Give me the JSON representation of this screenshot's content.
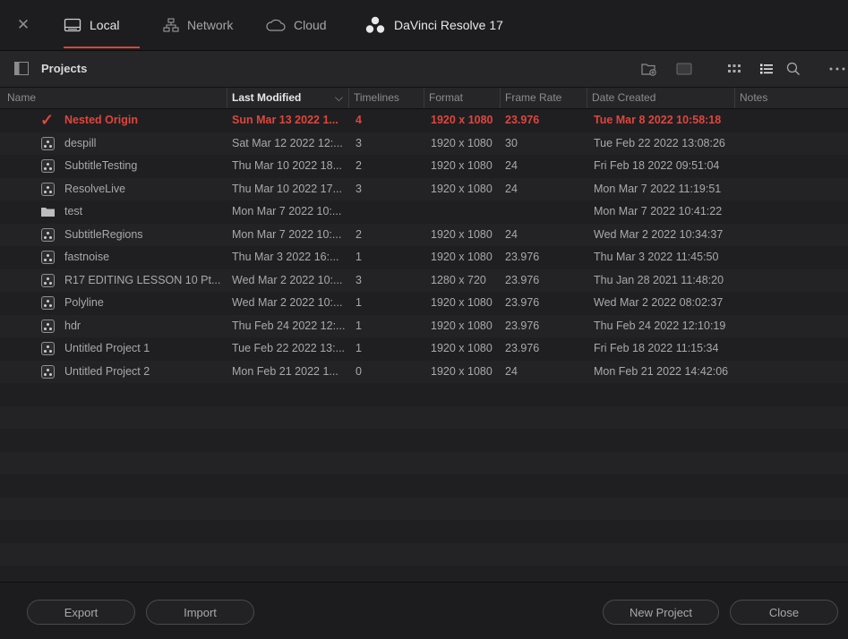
{
  "tabs": {
    "local": "Local",
    "network": "Network",
    "cloud": "Cloud"
  },
  "app_title": "DaVinci Resolve 17",
  "toolbar": {
    "title": "Projects"
  },
  "columns": {
    "name": "Name",
    "last_modified": "Last Modified",
    "timelines": "Timelines",
    "format": "Format",
    "frame_rate": "Frame Rate",
    "date_created": "Date Created",
    "notes": "Notes"
  },
  "projects": [
    {
      "icon": "checkmark-icon",
      "name": "Nested Origin",
      "modified": "Sun Mar 13 2022 1...",
      "timelines": "4",
      "format": "1920 x 1080",
      "frame_rate": "23.976",
      "created": "Tue Mar 8 2022 10:58:18",
      "active": true
    },
    {
      "icon": "resolve-project-icon",
      "name": "despill",
      "modified": "Sat Mar 12 2022 12:...",
      "timelines": "3",
      "format": "1920 x 1080",
      "frame_rate": "30",
      "created": "Tue Feb 22 2022 13:08:26"
    },
    {
      "icon": "resolve-project-icon",
      "name": "SubtitleTesting",
      "modified": "Thu Mar 10 2022 18...",
      "timelines": "2",
      "format": "1920 x 1080",
      "frame_rate": "24",
      "created": "Fri Feb 18 2022 09:51:04"
    },
    {
      "icon": "resolve-project-icon",
      "name": "ResolveLive",
      "modified": "Thu Mar 10 2022 17...",
      "timelines": "3",
      "format": "1920 x 1080",
      "frame_rate": "24",
      "created": "Mon Mar 7 2022 11:19:51"
    },
    {
      "icon": "folder-icon",
      "name": "test",
      "modified": "Mon Mar 7 2022 10:...",
      "timelines": "",
      "format": "",
      "frame_rate": "",
      "created": "Mon Mar 7 2022 10:41:22"
    },
    {
      "icon": "resolve-project-icon",
      "name": "SubtitleRegions",
      "modified": "Mon Mar 7 2022 10:...",
      "timelines": "2",
      "format": "1920 x 1080",
      "frame_rate": "24",
      "created": "Wed Mar 2 2022 10:34:37"
    },
    {
      "icon": "resolve-project-icon",
      "name": "fastnoise",
      "modified": "Thu Mar 3 2022 16:...",
      "timelines": "1",
      "format": "1920 x 1080",
      "frame_rate": "23.976",
      "created": "Thu Mar 3 2022 11:45:50"
    },
    {
      "icon": "resolve-project-icon",
      "name": "R17 EDITING LESSON 10 Pt...",
      "modified": "Wed Mar 2 2022 10:...",
      "timelines": "3",
      "format": "1280 x 720",
      "frame_rate": "23.976",
      "created": "Thu Jan 28 2021 11:48:20"
    },
    {
      "icon": "resolve-project-icon",
      "name": "Polyline",
      "modified": "Wed Mar 2 2022 10:...",
      "timelines": "1",
      "format": "1920 x 1080",
      "frame_rate": "23.976",
      "created": "Wed Mar 2 2022 08:02:37"
    },
    {
      "icon": "resolve-project-icon",
      "name": "hdr",
      "modified": "Thu Feb 24 2022 12:...",
      "timelines": "1",
      "format": "1920 x 1080",
      "frame_rate": "23.976",
      "created": "Thu Feb 24 2022 12:10:19"
    },
    {
      "icon": "resolve-project-icon",
      "name": "Untitled Project 1",
      "modified": "Tue Feb 22 2022 13:...",
      "timelines": "1",
      "format": "1920 x 1080",
      "frame_rate": "23.976",
      "created": "Fri Feb 18 2022 11:15:34"
    },
    {
      "icon": "resolve-project-icon",
      "name": "Untitled Project 2",
      "modified": "Mon Feb 21 2022 1...",
      "timelines": "0",
      "format": "1920 x 1080",
      "frame_rate": "24",
      "created": "Mon Feb 21 2022 14:42:06"
    }
  ],
  "buttons": {
    "export": "Export",
    "import": "Import",
    "new_project": "New Project",
    "close": "Close"
  },
  "colors": {
    "accent": "#e0453c",
    "background": "#1b1b1d"
  }
}
